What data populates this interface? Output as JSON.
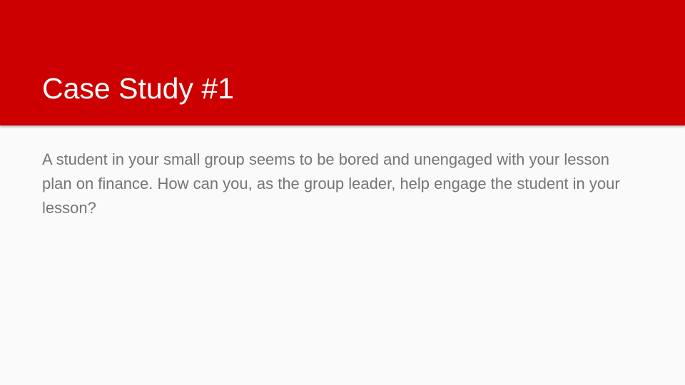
{
  "slide": {
    "title": "Case Study #1",
    "body": "A student in your small group seems to be bored and unengaged with your lesson plan on finance. How can you, as the group leader, help engage the student in your lesson?"
  },
  "colors": {
    "header_background": "#cc0000",
    "title_text": "#ffffff",
    "body_text": "#757575",
    "slide_background": "#fafafa"
  }
}
